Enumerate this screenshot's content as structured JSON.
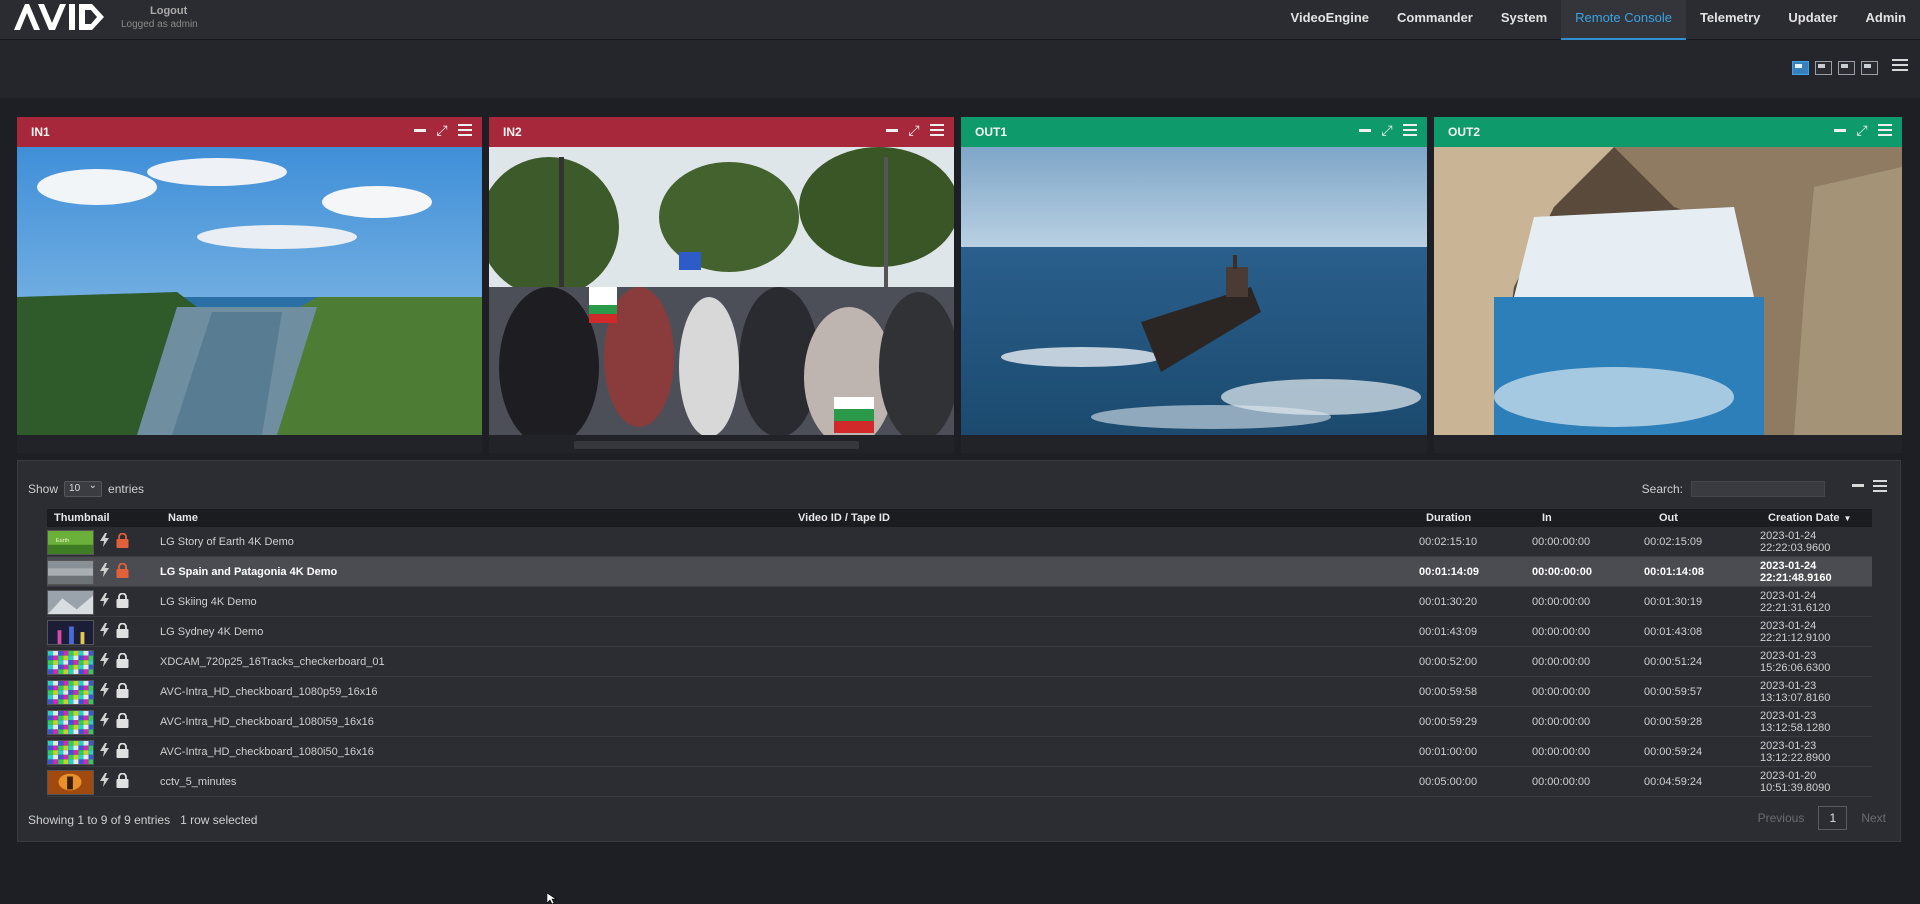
{
  "header": {
    "logout_label": "Logout",
    "logged_in_text": "Logged as admin",
    "nav": [
      "VideoEngine",
      "Commander",
      "System",
      "Remote Console",
      "Telemetry",
      "Updater",
      "Admin"
    ],
    "active_nav": "Remote Console"
  },
  "panels": [
    {
      "title": "IN1",
      "type": "in"
    },
    {
      "title": "IN2",
      "type": "in"
    },
    {
      "title": "OUT1",
      "type": "out"
    },
    {
      "title": "OUT2",
      "type": "out"
    }
  ],
  "table": {
    "show_label": "Show",
    "page_size": "10",
    "entries_label": "entries",
    "search_label": "Search:",
    "columns": {
      "thumbnail": "Thumbnail",
      "name": "Name",
      "video_id": "Video ID / Tape ID",
      "duration": "Duration",
      "in": "In",
      "out": "Out",
      "creation_date": "Creation Date"
    },
    "rows": [
      {
        "name": "LG Story of Earth 4K Demo",
        "duration": "00:02:15:10",
        "in": "00:00:00:00",
        "out": "00:02:15:09",
        "date": "2023-01-24",
        "time": "22:22:03.9600",
        "thumb": "green",
        "locked": true
      },
      {
        "name": "LG Spain and Patagonia 4K Demo",
        "duration": "00:01:14:09",
        "in": "00:00:00:00",
        "out": "00:01:14:08",
        "date": "2023-01-24",
        "time": "22:21:48.9160",
        "thumb": "landscape",
        "locked": true,
        "selected": true
      },
      {
        "name": "LG Skiing 4K Demo",
        "duration": "00:01:30:20",
        "in": "00:00:00:00",
        "out": "00:01:30:19",
        "date": "2023-01-24",
        "time": "22:21:31.6120",
        "thumb": "snow",
        "locked": false
      },
      {
        "name": "LG Sydney 4K Demo",
        "duration": "00:01:43:09",
        "in": "00:00:00:00",
        "out": "00:01:43:08",
        "date": "2023-01-24",
        "time": "22:21:12.9100",
        "thumb": "night",
        "locked": false
      },
      {
        "name": "XDCAM_720p25_16Tracks_checkerboard_01",
        "duration": "00:00:52:00",
        "in": "00:00:00:00",
        "out": "00:00:51:24",
        "date": "2023-01-23",
        "time": "15:26:06.6300",
        "thumb": "checker",
        "locked": false
      },
      {
        "name": "AVC-Intra_HD_checkboard_1080p59_16x16",
        "duration": "00:00:59:58",
        "in": "00:00:00:00",
        "out": "00:00:59:57",
        "date": "2023-01-23",
        "time": "13:13:07.8160",
        "thumb": "checker",
        "locked": false
      },
      {
        "name": "AVC-Intra_HD_checkboard_1080i59_16x16",
        "duration": "00:00:59:29",
        "in": "00:00:00:00",
        "out": "00:00:59:28",
        "date": "2023-01-23",
        "time": "13:12:58.1280",
        "thumb": "checker",
        "locked": false
      },
      {
        "name": "AVC-Intra_HD_checkboard_1080i50_16x16",
        "duration": "00:01:00:00",
        "in": "00:00:00:00",
        "out": "00:00:59:24",
        "date": "2023-01-23",
        "time": "13:12:22.8900",
        "thumb": "checker",
        "locked": false
      },
      {
        "name": "cctv_5_minutes",
        "duration": "00:05:00:00",
        "in": "00:00:00:00",
        "out": "00:04:59:24",
        "date": "2023-01-20",
        "time": "10:51:39.8090",
        "thumb": "orange",
        "locked": false
      }
    ],
    "info": "Showing 1 to 9 of 9 entries",
    "selected_info": "1 row selected",
    "pagination": {
      "previous": "Previous",
      "page": "1",
      "next": "Next"
    }
  },
  "colors": {
    "in_header": "#a8283b",
    "out_header": "#0e9a6a",
    "accent": "#3aa3e3",
    "lock_active": "#e0603a"
  }
}
